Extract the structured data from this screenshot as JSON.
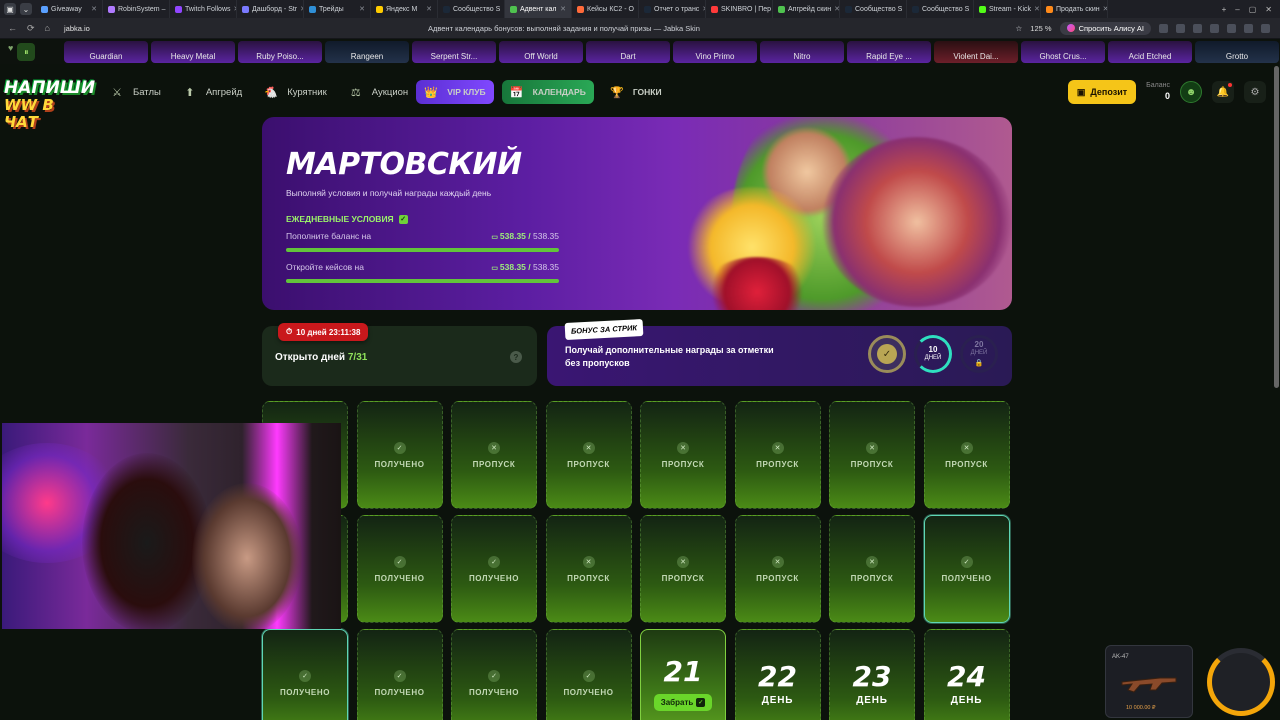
{
  "browser": {
    "tabs": [
      {
        "label": "Giveaway",
        "color": "#5aa0ff",
        "active": false
      },
      {
        "label": "RobinSystem –",
        "color": "#b07aff",
        "active": false
      },
      {
        "label": "Twitch Follows",
        "color": "#9146ff",
        "active": false
      },
      {
        "label": "Дашборд - Str",
        "color": "#7a7aff",
        "active": false
      },
      {
        "label": "Трейды",
        "color": "#2f8fd6",
        "active": false
      },
      {
        "label": "Яндекс М",
        "color": "#ffcc00",
        "active": false
      },
      {
        "label": "Сообщество S",
        "color": "#1b2838",
        "active": false
      },
      {
        "label": "Адвент кал",
        "color": "#4fc24f",
        "active": true
      },
      {
        "label": "Кейсы КС2 - О",
        "color": "#ff6a3a",
        "active": false
      },
      {
        "label": "Отчет о транс",
        "color": "#1b2838",
        "active": false
      },
      {
        "label": "SKINBRO | Пер",
        "color": "#ff3a3a",
        "active": false
      },
      {
        "label": "Апгрейд скин",
        "color": "#4fc24f",
        "active": false
      },
      {
        "label": "Сообщество S",
        "color": "#1b2838",
        "active": false
      },
      {
        "label": "Сообщество S",
        "color": "#1b2838",
        "active": false
      },
      {
        "label": "Stream - Kick",
        "color": "#53fc18",
        "active": false
      },
      {
        "label": "Продать скин",
        "color": "#ff8a1a",
        "active": false
      }
    ],
    "url": "jabka.io",
    "page_title": "Адвент календарь бонусов: выполняй задания и получай призы — Jabka Skin",
    "zoom": "125 %",
    "alice_label": "Спросить Алису AI"
  },
  "ticker": {
    "skins": [
      {
        "name": "Guardian",
        "tone": "p"
      },
      {
        "name": "Heavy Metal",
        "tone": "p"
      },
      {
        "name": "Ruby Poiso...",
        "tone": "p"
      },
      {
        "name": "Rangeen",
        "tone": "g"
      },
      {
        "name": "Serpent Str...",
        "tone": "p"
      },
      {
        "name": "Off World",
        "tone": "p"
      },
      {
        "name": "Dart",
        "tone": "p"
      },
      {
        "name": "Vino Primo",
        "tone": "p"
      },
      {
        "name": "Nitro",
        "tone": "p"
      },
      {
        "name": "Rapid Eye ...",
        "tone": "p"
      },
      {
        "name": "Violent Dai...",
        "tone": "r"
      },
      {
        "name": "Ghost Crus...",
        "tone": "p"
      },
      {
        "name": "Acid Etched",
        "tone": "p"
      },
      {
        "name": "Grotto",
        "tone": "g"
      }
    ]
  },
  "header": {
    "logo_line1": "НАПИШИ",
    "logo_line2": "WW В ЧАТ",
    "nav": [
      {
        "label": "Батлы",
        "icon": "battle-icon"
      },
      {
        "label": "Апгрейд",
        "icon": "upgrade-icon"
      },
      {
        "label": "Курятник",
        "icon": "chicken-icon"
      },
      {
        "label": "Аукцион",
        "icon": "auction-icon"
      }
    ],
    "pills": [
      {
        "label": "VIP КЛУБ",
        "icon": "crown-icon"
      },
      {
        "label": "КАЛЕНДАРЬ",
        "icon": "calendar-icon"
      },
      {
        "label": "ГОНКИ",
        "icon": "trophy-icon"
      }
    ],
    "deposit_label": "Депозит",
    "balance_label": "Баланс",
    "balance_value": "0"
  },
  "banner": {
    "title": "МАРТОВСКИЙ",
    "subtitle": "Выполняй условия и получай награды каждый день",
    "daily_label": "ЕЖЕДНЕВНЫЕ УСЛОВИЯ",
    "conditions": [
      {
        "label": "Пополните баланс на",
        "value": "538.35",
        "total": "538.35",
        "progress": 1.0
      },
      {
        "label": "Откройте кейсов на",
        "value": "538.35",
        "total": "538.35",
        "progress": 1.0
      }
    ]
  },
  "days_panel": {
    "timer": "10 дней 23:11:38",
    "opened_label": "Открыто дней",
    "opened_value": "7/31",
    "help": "?"
  },
  "stream_panel": {
    "badge": "БОНУС ЗА СТРИК",
    "text": "Получай дополнительные награды за отметки без пропусков",
    "rings": [
      {
        "num": "10",
        "unit": "ДНЕЙ"
      },
      {
        "num": "20",
        "unit": "ДНЕЙ"
      }
    ]
  },
  "calendar": {
    "received": "ПОЛУЧЕНО",
    "missed": "ПРОПУСК",
    "day_word": "ДЕНЬ",
    "collect_label": "Забрать",
    "rows": [
      [
        "received",
        "received",
        "missed",
        "missed",
        "missed",
        "missed",
        "missed",
        "missed"
      ],
      [
        "received",
        "received",
        "received",
        "missed",
        "missed",
        "missed",
        "missed",
        "received-claim"
      ],
      [
        "received-claim",
        "received",
        "received",
        "received",
        "today",
        "future",
        "future",
        "future"
      ]
    ],
    "future_days": [
      "21",
      "22",
      "23",
      "24"
    ]
  },
  "weapon_card": {
    "name": "AK-47",
    "price": "10 000.00 ₽"
  }
}
